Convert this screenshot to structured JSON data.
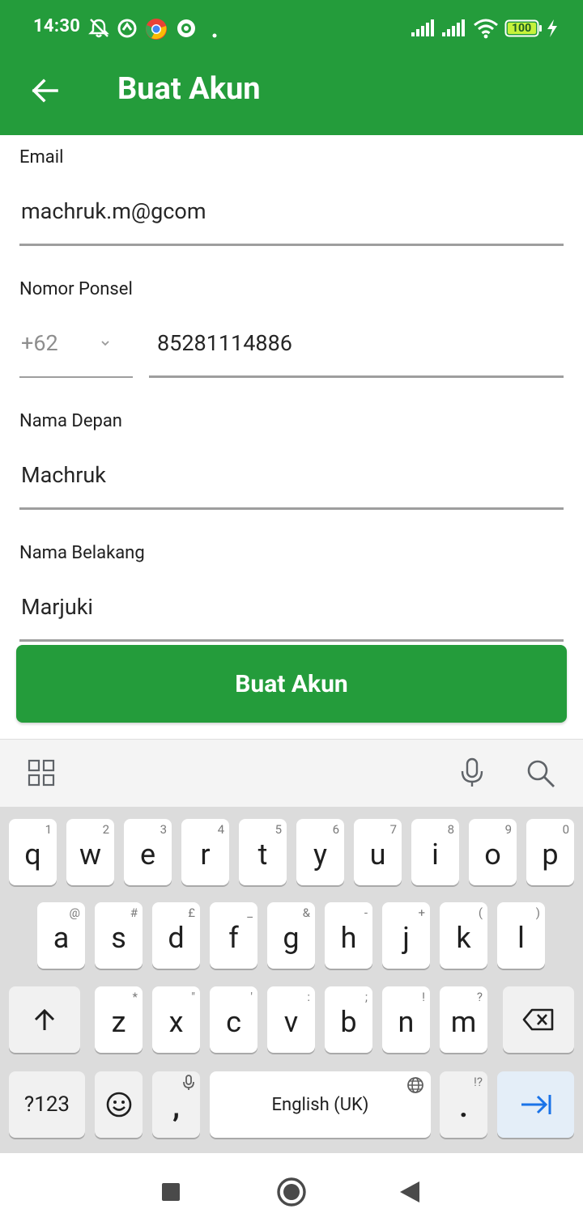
{
  "status_bar": {
    "time": "14:30",
    "battery": "100"
  },
  "app_bar": {
    "title": "Buat Akun"
  },
  "form": {
    "email_label": "Email",
    "email_value": "machruk.m@gcom",
    "phone_label": "Nomor Ponsel",
    "country_code": "+62",
    "phone_value": "85281114886",
    "first_name_label": "Nama Depan",
    "first_name_value": "Machruk",
    "last_name_label": "Nama Belakang",
    "last_name_value": "Marjuki",
    "submit_label": "Buat Akun"
  },
  "keyboard": {
    "row1": [
      {
        "k": "q",
        "h": "1"
      },
      {
        "k": "w",
        "h": "2"
      },
      {
        "k": "e",
        "h": "3"
      },
      {
        "k": "r",
        "h": "4"
      },
      {
        "k": "t",
        "h": "5"
      },
      {
        "k": "y",
        "h": "6"
      },
      {
        "k": "u",
        "h": "7"
      },
      {
        "k": "i",
        "h": "8"
      },
      {
        "k": "o",
        "h": "9"
      },
      {
        "k": "p",
        "h": "0"
      }
    ],
    "row2": [
      {
        "k": "a",
        "h": "@"
      },
      {
        "k": "s",
        "h": "#"
      },
      {
        "k": "d",
        "h": "£"
      },
      {
        "k": "f",
        "h": "_"
      },
      {
        "k": "g",
        "h": "&"
      },
      {
        "k": "h",
        "h": "-"
      },
      {
        "k": "j",
        "h": "+"
      },
      {
        "k": "k",
        "h": "("
      },
      {
        "k": "l",
        "h": ")"
      }
    ],
    "row3": [
      {
        "k": "z",
        "h": "*"
      },
      {
        "k": "x",
        "h": "\""
      },
      {
        "k": "c",
        "h": "'"
      },
      {
        "k": "v",
        "h": ":"
      },
      {
        "k": "b",
        "h": ";"
      },
      {
        "k": "n",
        "h": "!"
      },
      {
        "k": "m",
        "h": "?"
      }
    ],
    "symbols_key": "?123",
    "comma_key": ",",
    "space_label": "English (UK)",
    "period_key": ".",
    "period_hint": "!?"
  }
}
